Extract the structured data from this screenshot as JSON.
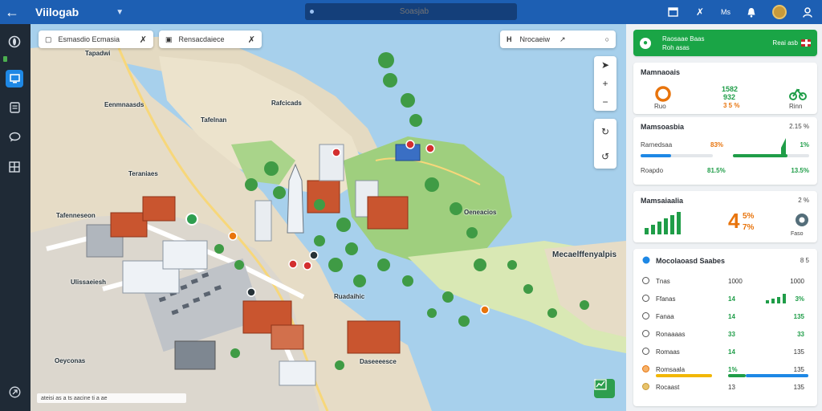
{
  "app": {
    "title": "Viilogab",
    "search_placeholder": "Soasjab",
    "top_label": "Ms"
  },
  "map": {
    "pill_left": "Esmasdio Ecmasia",
    "pill_mid": "Rensacdaiece",
    "pill_right": "Nrocaeiw",
    "labels": [
      "Tapadwi",
      "Eenmnaasds",
      "Tafelnan",
      "Rafcicads",
      "Teraniaes",
      "Tafenneseon",
      "Ulissaeiesh",
      "Oeyconas",
      "Ruadaihic",
      "Mecaelffenyalpis",
      "Oeneacios",
      "Daseeeesce"
    ],
    "footer_text": "ateisi as a ts aacine ti a ae"
  },
  "panel": {
    "banner": {
      "line1": "Raosaae Baas",
      "line2": "Roh asas",
      "right_text": "Reai asb"
    },
    "card2": {
      "title": "Mamnaoais",
      "stats": [
        {
          "value": "1582",
          "sub": "1 ou"
        },
        {
          "value": "932",
          "sub": "3 5 %"
        }
      ],
      "icon_label": "Ruo",
      "icon_label2": "Rinn"
    },
    "card3": {
      "title": "Mamsoasbia",
      "pct": "2.15 %",
      "row1_label": "Rarnedsaa",
      "row1_v1": "83%",
      "row1_v2": "1%",
      "row1_fill_left": 0.42,
      "row1_fill_right": 0.72,
      "row2_label": "Roapdo",
      "row2_v1": "81.5%",
      "row2_v2": "13.5%"
    },
    "card4": {
      "title": "Mamsaiaalia",
      "pct": "2 %",
      "big_value": "4",
      "big_pct": "5%",
      "big_pct2": "7%",
      "gauge_label": "Faso"
    },
    "card5": {
      "title": "Mocolaoasd Saabes",
      "title_right": "8 5",
      "rows": [
        {
          "label": "Tnas",
          "value": "1000",
          "right": "1000"
        },
        {
          "label": "Ffanas",
          "value": "14",
          "right": "3%"
        },
        {
          "label": "Fanaa",
          "value": "14",
          "right": "135"
        },
        {
          "label": "Ronaaaas",
          "value": "33",
          "right": "33"
        },
        {
          "label": "Romaas",
          "value": "14",
          "right": "135"
        },
        {
          "label": "Romsaala",
          "value": "1%",
          "right": "135"
        },
        {
          "label": "Rocaast",
          "value": "13",
          "right": "135"
        }
      ]
    }
  },
  "colors": {
    "topbar": "#1d5fb3",
    "rail": "#1f2a36",
    "accent_green": "#1aa546",
    "accent_blue": "#1e88e5",
    "accent_orange": "#e8740c",
    "water": "#a7d0ec"
  }
}
